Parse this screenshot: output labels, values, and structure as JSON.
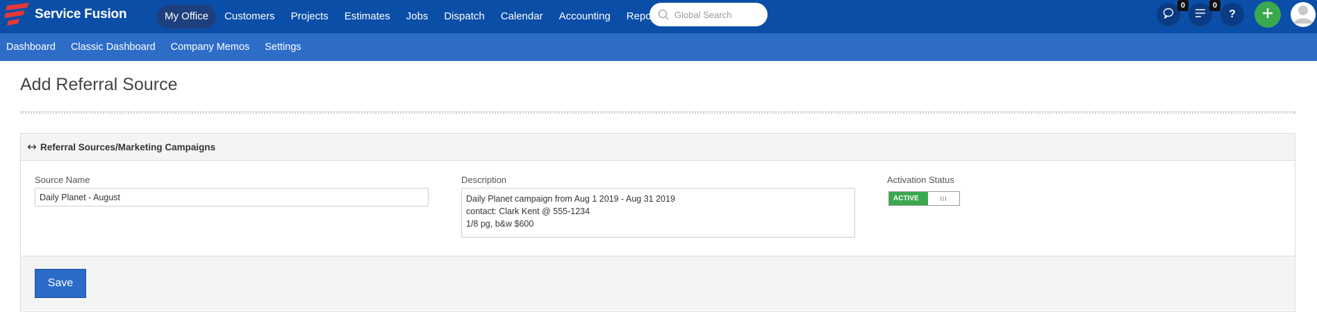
{
  "app": {
    "name": "Service Fusion",
    "brand_color": "#0a4ea8",
    "accent_red": "#e53935",
    "success_green": "#3aa84f"
  },
  "main_nav": {
    "items": [
      {
        "label": "My Office",
        "active": true
      },
      {
        "label": "Customers"
      },
      {
        "label": "Projects"
      },
      {
        "label": "Estimates"
      },
      {
        "label": "Jobs"
      },
      {
        "label": "Dispatch"
      },
      {
        "label": "Calendar"
      },
      {
        "label": "Accounting"
      },
      {
        "label": "Reports"
      }
    ]
  },
  "search": {
    "placeholder": "Global Search",
    "icon": "search-icon"
  },
  "header_actions": {
    "chat": {
      "icon": "chat-bubble-icon",
      "badge": "0"
    },
    "tasks": {
      "icon": "list-icon",
      "badge": "0"
    },
    "help": {
      "label": "?"
    },
    "add": {
      "icon": "plus-icon"
    },
    "avatar": {
      "icon": "user-avatar-icon"
    }
  },
  "sub_nav": {
    "items": [
      {
        "label": "Dashboard"
      },
      {
        "label": "Classic Dashboard"
      },
      {
        "label": "Company Memos"
      },
      {
        "label": "Settings"
      }
    ]
  },
  "page": {
    "title": "Add Referral Source"
  },
  "panel": {
    "title": "Referral Sources/Marketing Campaigns",
    "icon": "horizontal-arrows-icon",
    "source_name": {
      "label": "Source Name",
      "value": "Daily Planet - August"
    },
    "description": {
      "label": "Description",
      "value": "Daily Planet campaign from Aug 1 2019 - Aug 31 2019\ncontact: Clark Kent @ 555-1234\n1/8 pg, b&w $600"
    },
    "activation": {
      "label": "Activation Status",
      "state": "ACTIVE",
      "handle": "III"
    },
    "save_label": "Save"
  }
}
